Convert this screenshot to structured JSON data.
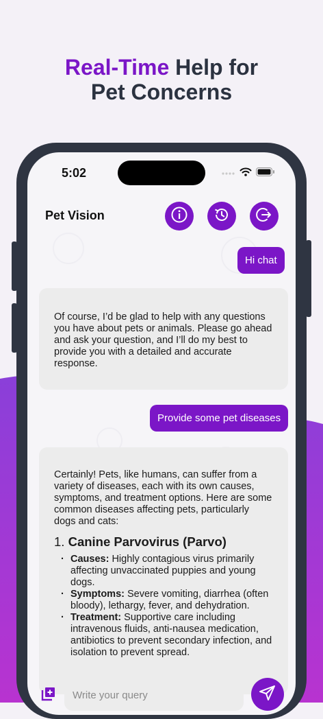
{
  "headline": {
    "accent": "Real-Time",
    "rest_line1": " Help for",
    "line2": "Pet Concerns"
  },
  "status_bar": {
    "time": "5:02",
    "icons": [
      "signal-icon",
      "wifi-icon",
      "battery-icon"
    ]
  },
  "header": {
    "title": "Pet Vision",
    "buttons": [
      "info-icon",
      "history-icon",
      "logout-icon"
    ]
  },
  "chat": {
    "messages": [
      {
        "role": "user",
        "text": "Hi chat"
      },
      {
        "role": "assistant",
        "text": "Of course, I’d be glad to help with any questions you have about pets or animals. Please go ahead and ask your question, and I’ll do my best to provide you with a detailed and accurate response."
      },
      {
        "role": "user",
        "text": "Provide some pet diseases"
      },
      {
        "role": "assistant",
        "intro": "Certainly! Pets, like humans, can suffer from a variety of diseases, each with its own causes, symptoms, and treatment options. Here are some common diseases affecting pets, particularly dogs and cats:",
        "heading_number": "1.",
        "heading_title": "Canine Parvovirus (Parvo)",
        "items": [
          {
            "label": "Causes:",
            "text": " Highly contagious virus primarily affecting unvaccinated puppies and young dogs."
          },
          {
            "label": "Symptoms:",
            "text": " Severe vomiting, diarrhea (often bloody), lethargy, fever, and dehydration."
          },
          {
            "label": "Treatment:",
            "text": " Supportive care including intravenous fluids, anti-nausea medication, antibiotics to prevent secondary infection, and isolation to prevent spread."
          }
        ]
      }
    ]
  },
  "composer": {
    "placeholder": "Write your query",
    "add_icon": "add-media-icon",
    "send_icon": "send-icon"
  },
  "colors": {
    "accent": "#7b16c7",
    "headline_text": "#2b3240",
    "phone_frame": "#2f3542",
    "bot_bubble": "#ececec"
  }
}
